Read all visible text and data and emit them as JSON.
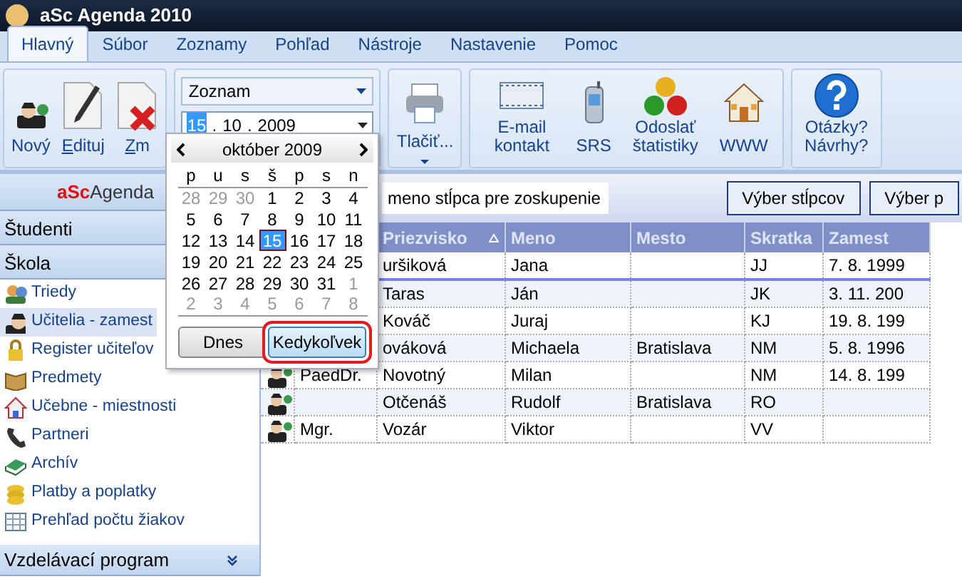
{
  "window": {
    "title": "aSc Agenda 2010"
  },
  "menu_tabs": [
    {
      "label": "Hlavný",
      "selected": true
    },
    {
      "label": "Súbor",
      "selected": false
    },
    {
      "label": "Zoznamy",
      "selected": false
    },
    {
      "label": "Pohľad",
      "selected": false
    },
    {
      "label": "Nástroje",
      "selected": false
    },
    {
      "label": "Nastavenie",
      "selected": false
    },
    {
      "label": "Pomoc",
      "selected": false
    }
  ],
  "ribbon": {
    "edit_buttons": [
      {
        "label": "Nový",
        "underline_first": false
      },
      {
        "label": "Edituj",
        "underline_first": true
      },
      {
        "label": "Zm",
        "underline_first": true
      }
    ],
    "view_select": {
      "value": "Zoznam"
    },
    "date_field": {
      "parts": [
        {
          "text": "15",
          "selected": true
        },
        {
          "text": ".",
          "selected": false
        },
        {
          "text": "10",
          "selected": false
        },
        {
          "text": ".",
          "selected": false
        },
        {
          "text": "2009",
          "selected": false
        }
      ]
    },
    "print_button": {
      "label": "Tlačiť..."
    },
    "tool_buttons": [
      {
        "label": "E-mail kontakt"
      },
      {
        "label": "SRS"
      },
      {
        "label": "Odoslať štatistiky"
      },
      {
        "label": "WWW"
      }
    ],
    "help_button": {
      "label": "Otázky? Návrhy?"
    }
  },
  "sidebar": {
    "logo_prefix": "aSc",
    "logo_text": "Agenda",
    "sections": [
      {
        "label": "Študenti"
      },
      {
        "label": "Škola"
      }
    ],
    "items": [
      {
        "label": "Triedy",
        "selected": false
      },
      {
        "label": "Učitelia - zamest",
        "selected": true
      },
      {
        "label": "Register učiteľov",
        "selected": false
      },
      {
        "label": "Predmety",
        "selected": false
      },
      {
        "label": "Učebne - miestnosti",
        "selected": false
      },
      {
        "label": "Partneri",
        "selected": false
      },
      {
        "label": "Archív",
        "selected": false
      },
      {
        "label": "Platby a poplatky",
        "selected": false
      },
      {
        "label": "Prehľad počtu žiakov",
        "selected": false
      }
    ],
    "bottom_section": {
      "label": "Vzdelávací program"
    }
  },
  "group_bar": {
    "hint": "meno stĺpca pre zoskupenie",
    "buttons": [
      "Výber stĺpcov",
      "Výber p"
    ]
  },
  "table": {
    "columns": [
      {
        "label": "Priezvisko",
        "sorted": true
      },
      {
        "label": "Meno",
        "sorted": false
      },
      {
        "label": "Mesto",
        "sorted": false
      },
      {
        "label": "Skratka",
        "sorted": false
      },
      {
        "label": "Zamest",
        "sorted": false
      }
    ],
    "rows": [
      {
        "focused": true,
        "cells": [
          "uršiková",
          "Jana",
          "",
          "JJ",
          "7. 8. 1999"
        ]
      },
      {
        "focused": false,
        "cells": [
          "Taras",
          "Ján",
          "",
          "JK",
          "3. 11. 200"
        ]
      },
      {
        "focused": false,
        "cells": [
          "Kováč",
          "Juraj",
          "",
          "KJ",
          "19. 8. 199"
        ]
      },
      {
        "focused": false,
        "cells": [
          "ováková",
          "Michaela",
          "Bratislava",
          "NM",
          "5. 8. 1996"
        ]
      },
      {
        "avatar": true,
        "title": "PaedDr.",
        "focused": false,
        "cells": [
          "Novotný",
          "Milan",
          "",
          "NM",
          "14. 8. 199"
        ]
      },
      {
        "avatar": true,
        "focused": false,
        "cells": [
          "Otčenáš",
          "Rudolf",
          "Bratislava",
          "RO",
          ""
        ]
      },
      {
        "avatar": true,
        "title": "Mgr.",
        "focused": false,
        "cells": [
          "Vozár",
          "Viktor",
          "",
          "VV",
          ""
        ]
      }
    ]
  },
  "calendar": {
    "month": "október 2009",
    "weekdays": [
      "p",
      "u",
      "s",
      "š",
      "p",
      "s",
      "n"
    ],
    "weeks": [
      [
        {
          "day": "28",
          "other_month": true,
          "selected": false
        },
        {
          "day": "29",
          "other_month": true,
          "selected": false
        },
        {
          "day": "30",
          "other_month": true,
          "selected": false
        },
        {
          "day": "1",
          "other_month": false,
          "selected": false
        },
        {
          "day": "2",
          "other_month": false,
          "selected": false
        },
        {
          "day": "3",
          "other_month": false,
          "selected": false
        },
        {
          "day": "4",
          "other_month": false,
          "selected": false
        }
      ],
      [
        {
          "day": "5",
          "other_month": false,
          "selected": false
        },
        {
          "day": "6",
          "other_month": false,
          "selected": false
        },
        {
          "day": "7",
          "other_month": false,
          "selected": false
        },
        {
          "day": "8",
          "other_month": false,
          "selected": false
        },
        {
          "day": "9",
          "other_month": false,
          "selected": false
        },
        {
          "day": "10",
          "other_month": false,
          "selected": false
        },
        {
          "day": "11",
          "other_month": false,
          "selected": false
        }
      ],
      [
        {
          "day": "12",
          "other_month": false,
          "selected": false
        },
        {
          "day": "13",
          "other_month": false,
          "selected": false
        },
        {
          "day": "14",
          "other_month": false,
          "selected": false
        },
        {
          "day": "15",
          "other_month": false,
          "selected": true
        },
        {
          "day": "16",
          "other_month": false,
          "selected": false
        },
        {
          "day": "17",
          "other_month": false,
          "selected": false
        },
        {
          "day": "18",
          "other_month": false,
          "selected": false
        }
      ],
      [
        {
          "day": "19",
          "other_month": false,
          "selected": false
        },
        {
          "day": "20",
          "other_month": false,
          "selected": false
        },
        {
          "day": "21",
          "other_month": false,
          "selected": false
        },
        {
          "day": "22",
          "other_month": false,
          "selected": false
        },
        {
          "day": "23",
          "other_month": false,
          "selected": false
        },
        {
          "day": "24",
          "other_month": false,
          "selected": false
        },
        {
          "day": "25",
          "other_month": false,
          "selected": false
        }
      ],
      [
        {
          "day": "26",
          "other_month": false,
          "selected": false
        },
        {
          "day": "27",
          "other_month": false,
          "selected": false
        },
        {
          "day": "28",
          "other_month": false,
          "selected": false
        },
        {
          "day": "29",
          "other_month": false,
          "selected": false
        },
        {
          "day": "30",
          "other_month": false,
          "selected": false
        },
        {
          "day": "31",
          "other_month": false,
          "selected": false
        },
        {
          "day": "1",
          "other_month": true,
          "selected": false
        }
      ],
      [
        {
          "day": "2",
          "other_month": true,
          "selected": false
        },
        {
          "day": "3",
          "other_month": true,
          "selected": false
        },
        {
          "day": "4",
          "other_month": true,
          "selected": false
        },
        {
          "day": "5",
          "other_month": true,
          "selected": false
        },
        {
          "day": "6",
          "other_month": true,
          "selected": false
        },
        {
          "day": "7",
          "other_month": true,
          "selected": false
        },
        {
          "day": "8",
          "other_month": true,
          "selected": false
        }
      ]
    ],
    "buttons": [
      {
        "label": "Dnes",
        "highlighted": false
      },
      {
        "label": "Kedykoľvek",
        "highlighted": true
      }
    ]
  }
}
